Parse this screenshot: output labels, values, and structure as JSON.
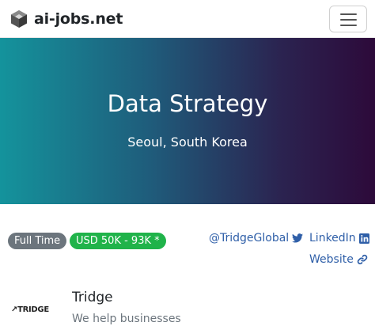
{
  "navbar": {
    "brand": "ai-jobs.net",
    "logo_icon": "hexagon-cube-icon",
    "menu_icon": "hamburger-menu-icon"
  },
  "hero": {
    "title": "Data Strategy",
    "location": "Seoul, South Korea",
    "gradient_colors": [
      "#14939c",
      "#2d0a3a"
    ]
  },
  "badges": {
    "type": "Full Time",
    "salary": "USD 50K - 93K *",
    "type_color": "#6c757d",
    "salary_color": "#20b34a"
  },
  "links": {
    "twitter": "@TridgeGlobal",
    "linkedin": "LinkedIn",
    "website": "Website",
    "link_color": "#2f5fa8"
  },
  "company": {
    "logo_text": "TRIDGE",
    "name": "Tridge",
    "description": "We help businesses"
  }
}
